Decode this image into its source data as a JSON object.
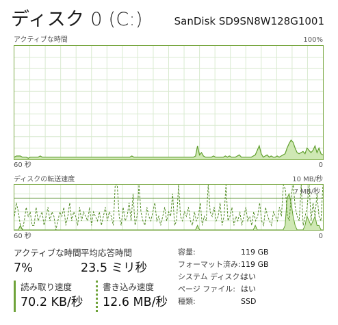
{
  "header": {
    "title": "ディスク 0 (C:)",
    "model": "SanDisk SD9SN8W128G1001"
  },
  "active_time_chart": {
    "label": "アクティブな時間",
    "max_label": "100%",
    "time_label": "60 秒",
    "min_label": "0",
    "grid_color": "#d9ead0",
    "line_color": "#5f9e2c",
    "fill_color": "#cfe8b4",
    "values": [
      2,
      3,
      3,
      3,
      2,
      2,
      2,
      1,
      2,
      2,
      2,
      2,
      2,
      3,
      2,
      2,
      2,
      2,
      2,
      2,
      2,
      2,
      2,
      2,
      2,
      2,
      2,
      2,
      2,
      2,
      2,
      2,
      2,
      2,
      2,
      2,
      2,
      2,
      2,
      2,
      2,
      2,
      2,
      2,
      2,
      2,
      2,
      2,
      2,
      2,
      2,
      2,
      2,
      2,
      2,
      2,
      2,
      2,
      2,
      3,
      2,
      2,
      2,
      2,
      2,
      2,
      2,
      2,
      2,
      2,
      2,
      2,
      2,
      2,
      2,
      2,
      2,
      2,
      2,
      2,
      2,
      2,
      2,
      2,
      2,
      2,
      2,
      2,
      2,
      2,
      2,
      3,
      12,
      4,
      6,
      3,
      2,
      2,
      2,
      2,
      3,
      2,
      2,
      2,
      2,
      2,
      3,
      2,
      3,
      2,
      2,
      2,
      3,
      4,
      2,
      2,
      2,
      2,
      2,
      2,
      3,
      4,
      8,
      12,
      5,
      2,
      3,
      4,
      2,
      3,
      2,
      2,
      3,
      2,
      3,
      4,
      5,
      10,
      14,
      17,
      15,
      10,
      6,
      5,
      6,
      7,
      5,
      10,
      8,
      6,
      8,
      12,
      6,
      10,
      5,
      4
    ]
  },
  "transfer_chart": {
    "label": "ディスクの転送速度",
    "max_label": "10 MB/秒",
    "ref_label": "7 MB/秒",
    "time_label": "60 秒",
    "min_label": "0",
    "ref_value": 7,
    "ymax": 10,
    "read_values": [
      0,
      0,
      0,
      1,
      0,
      0,
      0,
      0,
      0,
      0,
      0,
      0,
      0,
      0,
      0,
      0,
      0,
      0,
      0,
      0,
      0,
      0,
      0,
      0,
      0,
      0,
      0,
      0,
      0,
      0,
      0,
      0,
      0,
      0,
      0,
      0,
      0,
      0,
      0,
      0,
      0,
      0,
      0,
      0,
      0,
      0,
      0,
      0,
      0,
      0,
      0,
      0,
      0,
      0,
      0,
      0,
      0,
      0,
      0,
      0,
      0,
      0,
      0,
      0,
      0,
      0,
      0,
      0,
      0,
      0,
      0,
      0,
      0,
      0,
      0,
      0,
      0,
      0,
      0,
      0,
      0,
      0,
      0,
      0,
      0,
      0,
      0,
      0,
      0,
      0,
      0,
      0,
      1,
      0,
      0,
      0,
      0,
      0,
      0,
      0,
      0,
      0,
      0,
      0,
      0,
      0,
      0,
      0,
      0,
      0,
      0,
      0,
      0,
      0,
      0,
      0,
      0,
      0,
      0,
      0,
      0,
      1,
      0,
      0,
      0,
      0,
      0,
      0,
      0,
      0,
      0,
      0,
      0,
      0,
      0,
      0,
      1,
      7,
      8,
      6,
      3,
      1,
      0,
      0,
      0,
      0,
      1,
      3,
      2,
      1,
      2,
      3,
      1,
      1,
      0,
      0
    ],
    "write_values": [
      3,
      6,
      4,
      1,
      0,
      2,
      5,
      3,
      4,
      1,
      1,
      5,
      2,
      3,
      4,
      1,
      3,
      5,
      2,
      4,
      3,
      0,
      2,
      4,
      3,
      5,
      1,
      3,
      6,
      2,
      4,
      3,
      1,
      5,
      2,
      4,
      3,
      2,
      5,
      1,
      4,
      3,
      2,
      4,
      1,
      3,
      5,
      2,
      4,
      3,
      1,
      10,
      12,
      3,
      1,
      5,
      2,
      3,
      6,
      2,
      8,
      1,
      3,
      10,
      4,
      2,
      1,
      5,
      3,
      2,
      4,
      6,
      2,
      3,
      1,
      3,
      5,
      2,
      4,
      3,
      8,
      1,
      2,
      10,
      3,
      2,
      4,
      3,
      5,
      2,
      1,
      4,
      2,
      3,
      6,
      1,
      3,
      2,
      10,
      4,
      3,
      5,
      2,
      3,
      6,
      1,
      3,
      10,
      2,
      3,
      5,
      1,
      3,
      2,
      4,
      1,
      3,
      5,
      2,
      3,
      1,
      4,
      2,
      3,
      6,
      2,
      1,
      5,
      3,
      2,
      1,
      4,
      3,
      2,
      5,
      3,
      10,
      9,
      3,
      2,
      8,
      10,
      5,
      3,
      2,
      10,
      1,
      3,
      5,
      10,
      2,
      6,
      3,
      8,
      3,
      2,
      10
    ]
  },
  "stats": {
    "active_time_label": "アクティブな時間",
    "active_time_value": "7%",
    "avg_response_label": "平均応答時間",
    "avg_response_value": "23.5 ミリ秒",
    "read_speed_label": "読み取り速度",
    "read_speed_value": "70.2 KB/秒",
    "write_speed_label": "書き込み速度",
    "write_speed_value": "12.6 MB/秒"
  },
  "properties": [
    {
      "label": "容量:",
      "value": "119 GB"
    },
    {
      "label": "フォーマット済み:",
      "value": "119 GB"
    },
    {
      "label": "システム ディスク:",
      "value": "はい"
    },
    {
      "label": "ページ ファイル:",
      "value": "はい"
    },
    {
      "label": "種類:",
      "value": "SSD"
    }
  ]
}
